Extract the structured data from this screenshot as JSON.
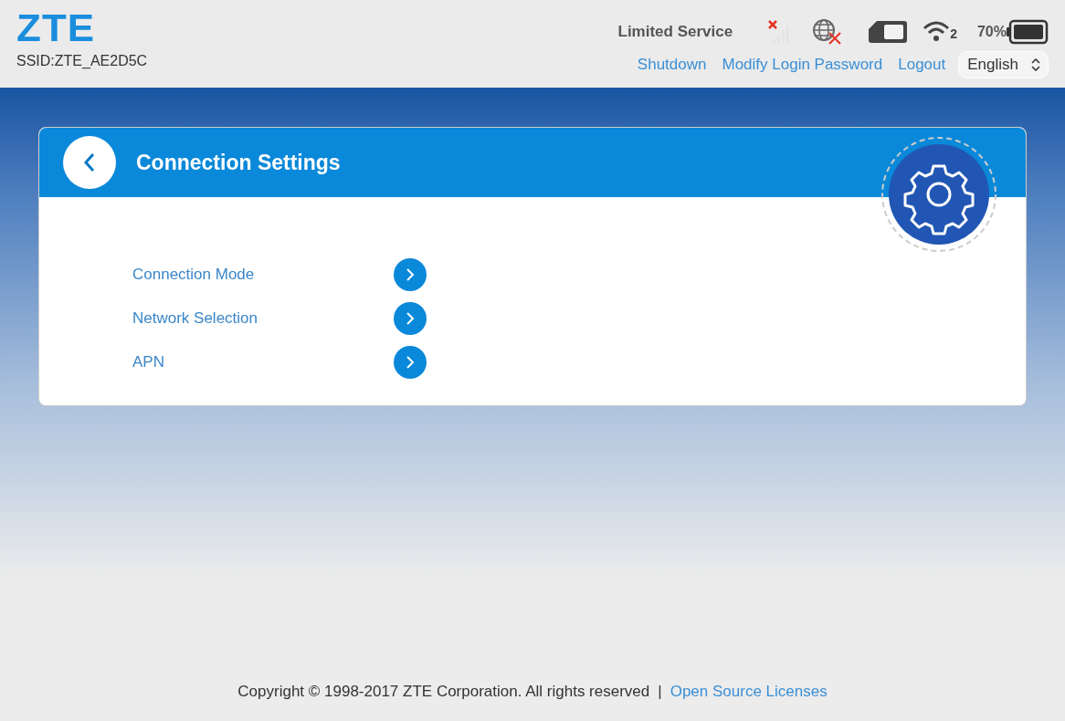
{
  "header": {
    "logo": "ZTE",
    "ssid": "SSID:ZTE_AE2D5C",
    "network_status": "Limited Service",
    "wifi_clients": "2",
    "battery_percent": "70%",
    "links": [
      "Shutdown",
      "Modify Login Password",
      "Logout"
    ],
    "language": "English"
  },
  "page": {
    "title": "Connection Settings",
    "items": [
      "Connection Mode",
      "Network Selection",
      "APN"
    ]
  },
  "footer": {
    "copyright": "Copyright © 1998-2017 ZTE Corporation. All rights reserved",
    "separator": "|",
    "link": "Open Source Licenses"
  }
}
